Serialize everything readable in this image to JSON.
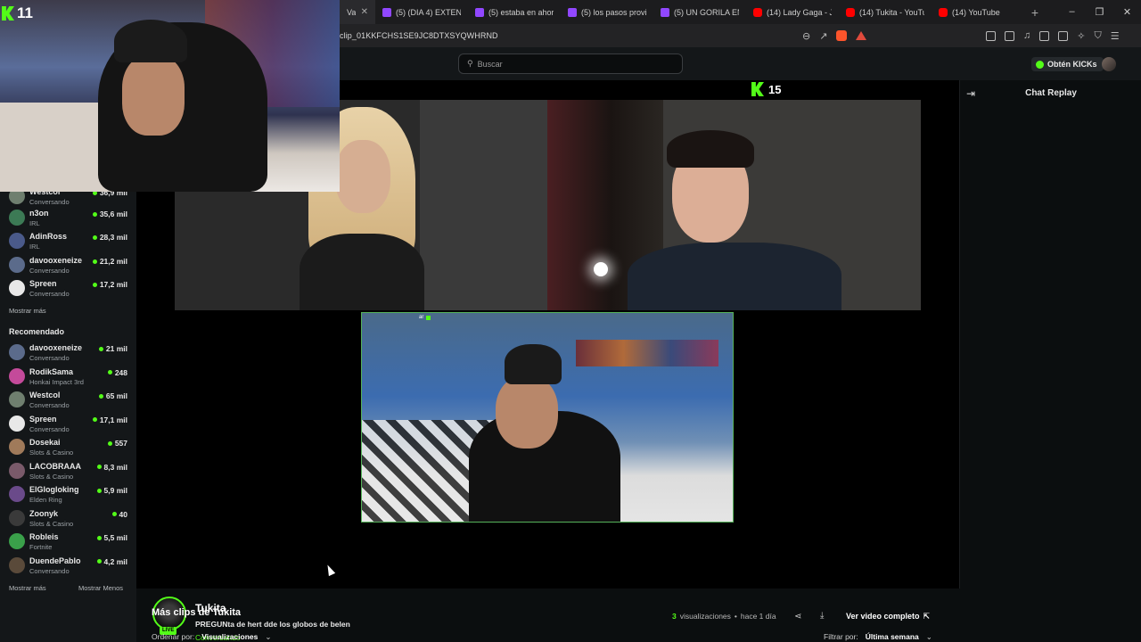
{
  "browser": {
    "tabs": [
      {
        "label": "Va",
        "icon": "none"
      },
      {
        "label": "(5) (DIA 4) EXTENSE",
        "icon": "twitch"
      },
      {
        "label": "(5) estaba en ahorr",
        "icon": "twitch"
      },
      {
        "label": "(5) los pasos provic",
        "icon": "twitch"
      },
      {
        "label": "(5) UN GORILA EN",
        "icon": "twitch"
      },
      {
        "label": "(14) Lady Gaga - Ju",
        "icon": "youtube"
      },
      {
        "label": "(14) Tukita - YouTub",
        "icon": "youtube"
      },
      {
        "label": "(14) YouTube",
        "icon": "youtube"
      }
    ],
    "new_tab": "+",
    "minimize": "–",
    "restore": "❐",
    "close": "✕",
    "url": "clip_01KKFCHS1SE9JC8DTXSYQWHRND"
  },
  "topnav": {
    "search_placeholder": "Buscar",
    "kicks_label": "Obtén KICKs"
  },
  "webcam": {
    "badge_count": "11"
  },
  "sidebar": {
    "following": [
      {
        "name": "Westcol",
        "category": "Conversando",
        "viewers": "36,9 mil",
        "color": "#6f7f6f"
      },
      {
        "name": "n3on",
        "category": "IRL",
        "viewers": "35,6 mil",
        "color": "#3c7a55"
      },
      {
        "name": "AdinRoss",
        "category": "IRL",
        "viewers": "28,3 mil",
        "color": "#4a5a8a"
      },
      {
        "name": "davooxeneize",
        "category": "Conversando",
        "viewers": "21,2 mil",
        "color": "#5b6b8b"
      },
      {
        "name": "Spreen",
        "category": "Conversando",
        "viewers": "17,2 mil",
        "color": "#e8e8e8"
      }
    ],
    "show_more": "Mostrar más",
    "recommended_heading": "Recomendado",
    "recommended": [
      {
        "name": "davooxeneize",
        "category": "Conversando",
        "viewers": "21 mil",
        "color": "#5b6b8b"
      },
      {
        "name": "RodikSama",
        "category": "Honkai Impact 3rd",
        "viewers": "248",
        "color": "#c44a9a"
      },
      {
        "name": "Westcol",
        "category": "Conversando",
        "viewers": "65 mil",
        "color": "#6f7f6f"
      },
      {
        "name": "Spreen",
        "category": "Conversando",
        "viewers": "17,1 mil",
        "color": "#e8e8e8"
      },
      {
        "name": "Dosekai",
        "category": "Slots & Casino",
        "viewers": "557",
        "color": "#a07a5a"
      },
      {
        "name": "LACOBRAAA",
        "category": "Slots & Casino",
        "viewers": "8,3 mil",
        "color": "#7a5a6a"
      },
      {
        "name": "ElGlogloking",
        "category": "Elden Ring",
        "viewers": "5,9 mil",
        "color": "#6a4a8a"
      },
      {
        "name": "Zoonyk",
        "category": "Slots & Casino",
        "viewers": "40",
        "color": "#3a3a3a"
      },
      {
        "name": "Robleis",
        "category": "Fortnite",
        "viewers": "5,5 mil",
        "color": "#3aa04a"
      },
      {
        "name": "DuendePablo",
        "category": "Conversando",
        "viewers": "4,2 mil",
        "color": "#5a4a3a"
      }
    ],
    "show_more_2": "Mostrar más",
    "show_less": "Mostrar Menos"
  },
  "video": {
    "viewer_count": "15",
    "panel_tag": "ar"
  },
  "chat": {
    "title": "Chat Replay"
  },
  "clip": {
    "channel": "Tukita",
    "live_badge": "LIVE",
    "title": "PREGUNta de hert dde los globos de belen",
    "category": "Conversando",
    "views_count": "3",
    "views_label": "visualizaciones",
    "separator": "•",
    "time_ago": "hace 1 día",
    "full_video": "Ver video completo",
    "full_video_icon": "⇱"
  },
  "more_clips": {
    "heading": "Más clips de Tukita",
    "sort_label": "Ordenar por:",
    "sort_value": "Visualizaciones",
    "filter_label": "Filtrar por:",
    "filter_value": "Última semana"
  },
  "colors": {
    "accent": "#53fc18",
    "background": "#0b0e0f",
    "sidebar": "#141719"
  }
}
